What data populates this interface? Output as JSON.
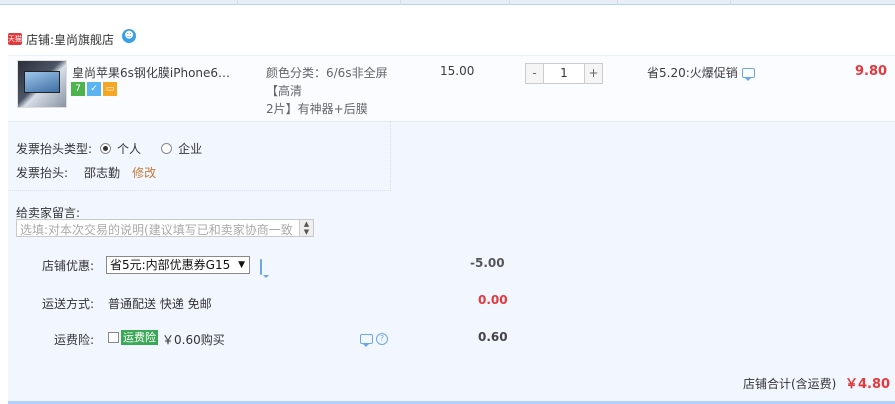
{
  "shop": {
    "icon_text": "天猫",
    "label": "店铺:",
    "name": "皇尚旗舰店",
    "ww_text": "☻"
  },
  "item": {
    "title": "皇尚苹果6s钢化膜iPhone6pl...",
    "badges": [
      "7",
      "✓",
      "▭"
    ],
    "sku_line1": "颜色分类：6/6s非全屏【高清",
    "sku_line2": "2片】有神器+后膜",
    "price": "15.00",
    "qty_minus": "-",
    "qty_value": "1",
    "qty_plus": "+",
    "promo": "省5.20:火爆促销",
    "subtotal": "9.80"
  },
  "invoice": {
    "type_label": "发票抬头类型:",
    "option_personal": "个人",
    "option_company": "企业",
    "title_label": "发票抬头:",
    "title_value": "邵志勤",
    "edit_link": "修改"
  },
  "message": {
    "label": "给卖家留言:",
    "placeholder": "选填:对本次交易的说明(建议填写已和卖家协商一致"
  },
  "discount": {
    "label": "店铺优惠:",
    "selected": "省5元:内部优惠券G15",
    "amount": "-5.00"
  },
  "shipping": {
    "label": "运送方式:",
    "method": "普通配送 快递 免邮",
    "amount": "0.00"
  },
  "insurance": {
    "label": "运费险:",
    "tag": "运费险",
    "price": "￥0.60购买",
    "amount": "0.60"
  },
  "total": {
    "label": "店铺合计(含运费)",
    "amount": "￥4.80"
  },
  "colors": {
    "accent_red": "#e4393c",
    "panel_blue": "#f2f7ff",
    "tag_green": "#3aa857"
  }
}
